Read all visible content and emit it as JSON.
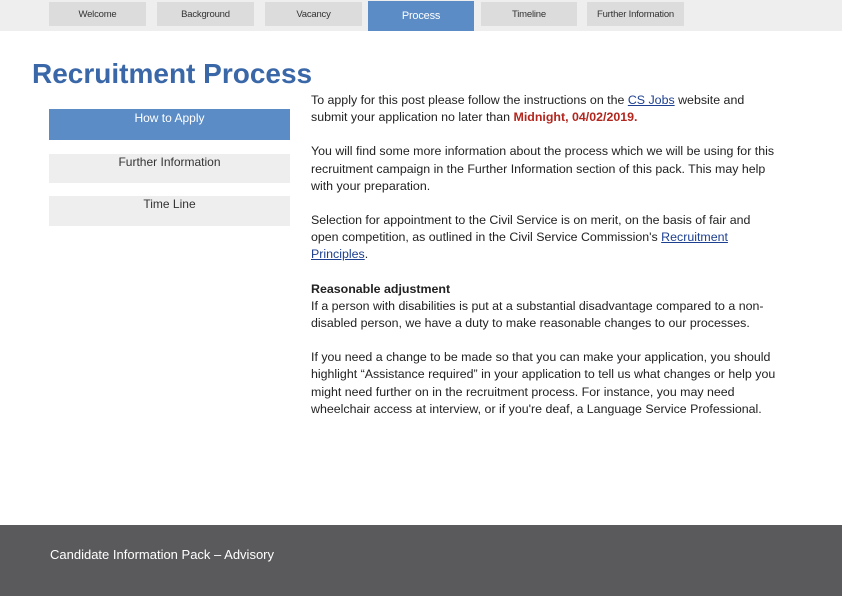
{
  "tabs": [
    {
      "label": "Welcome"
    },
    {
      "label": "Background"
    },
    {
      "label": "Vacancy"
    },
    {
      "label": "Process"
    },
    {
      "label": "Timeline"
    },
    {
      "label": "Further Information"
    }
  ],
  "active_tab": "Process",
  "page_title": "Recruitment Process",
  "sidenav": [
    {
      "label": "How to Apply"
    },
    {
      "label": "Further Information"
    },
    {
      "label": "Time Line"
    }
  ],
  "content": {
    "p1_before_link": "To apply for this post please follow the instructions on the ",
    "p1_link": "CS Jobs",
    "p1_after_link": " website and submit your application no later than ",
    "p1_deadline": "Midnight, 04/02/2019.",
    "p2": "You will find some more information about the process which we will be using for this recruitment campaign in the Further Information section of this pack. This may help with your preparation.",
    "p3_before_link": "Selection for appointment to the Civil Service is on merit, on the basis of fair and open competition, as outlined in the Civil Service Commission's ",
    "p3_link": "Recruitment Principles",
    "p3_after_link": ".",
    "reasonable_heading": "Reasonable adjustment",
    "p4": "If a person with disabilities is put at a substantial disadvantage compared to a non-disabled person, we have a duty to make reasonable changes to our processes.",
    "p5": "If you need a change to be made so that you can make your application, you should highlight “Assistance required” in your application to tell us what changes or help you might need further on in the recruitment process. For instance, you may need wheelchair access at interview, or if you're deaf, a Language Service Professional."
  },
  "footer": {
    "text": "Candidate Information Pack – Advisory"
  },
  "colors": {
    "accent": "#5b8cc6",
    "title": "#3a67a8",
    "deadline": "#b3261e",
    "footer_bg": "#5a5a5c"
  }
}
